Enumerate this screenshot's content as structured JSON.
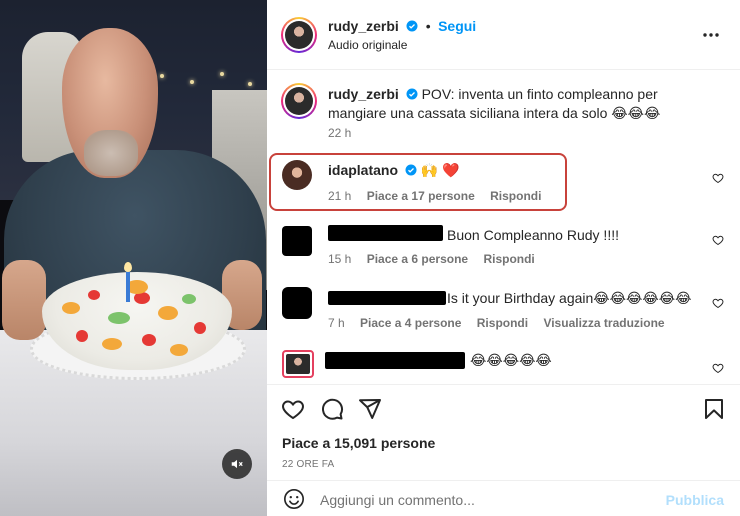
{
  "post": {
    "author": "rudy_zerbi",
    "separator": "•",
    "follow_label": "Segui",
    "audio": "Audio originale",
    "caption": "POV: inventa un finto compleanno per mangiare una cassata siciliana intera da solo 😂😂😂",
    "caption_time": "22 h"
  },
  "comments": [
    {
      "user": "idaplatano",
      "text": "🙌 ❤️",
      "time": "21 h",
      "likes": "Piace a 17 persone",
      "reply": "Rispondi",
      "verified": true
    },
    {
      "user": "",
      "text": "Buon Compleanno Rudy !!!!",
      "time": "15 h",
      "likes": "Piace a 6 persone",
      "reply": "Rispondi"
    },
    {
      "user": "",
      "text": "Is it your Birthday again😂😂😂😂😂😂",
      "time": "7 h",
      "likes": "Piace a 4 persone",
      "reply": "Rispondi",
      "translate": "Visualizza traduzione"
    },
    {
      "user": "",
      "text": "😂😂😂😂😂",
      "time": ""
    }
  ],
  "footer": {
    "likes": "Piace a 15,091 persone",
    "ago": "22 ORE FA",
    "comment_placeholder": "Aggiungi un commento...",
    "publish": "Pubblica"
  },
  "icons": {
    "more": "more-options-icon",
    "like": "heart-icon",
    "comment": "comment-icon",
    "share": "share-icon",
    "save": "bookmark-icon",
    "emoji": "emoji-icon",
    "mute": "speaker-muted-icon",
    "verified": "verified-badge-icon"
  },
  "colors": {
    "accent": "#0095f6",
    "verified": "#0095f6",
    "highlight": "#c8423b",
    "publish_disabled": "#b2dffc"
  }
}
